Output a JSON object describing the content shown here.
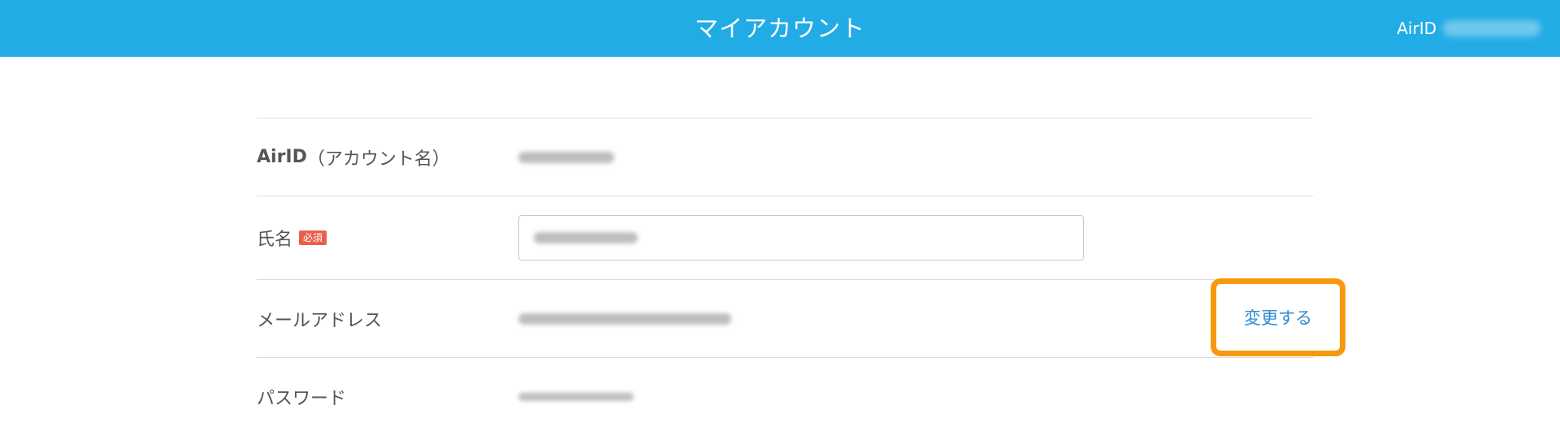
{
  "header": {
    "title": "マイアカウント",
    "user_prefix": "AirID"
  },
  "form": {
    "airid": {
      "label_bold": "AirID",
      "label_rest": "（アカウント名）"
    },
    "name": {
      "label": "氏名",
      "required_badge": "必須"
    },
    "email": {
      "label": "メールアドレス",
      "change_label": "変更する"
    },
    "password": {
      "label": "パスワード"
    }
  },
  "colors": {
    "header_bg": "#22ace5",
    "badge_bg": "#e8604c",
    "link": "#2c8ad4",
    "highlight": "#f8980e"
  }
}
